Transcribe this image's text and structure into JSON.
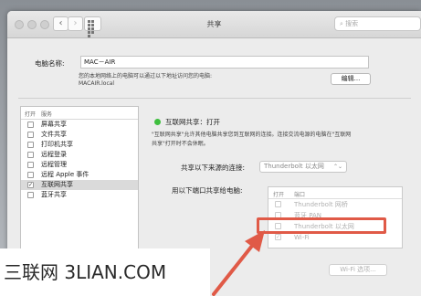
{
  "window": {
    "title": "共享",
    "search_placeholder": "搜索"
  },
  "computer_name": {
    "label": "电脑名称:",
    "value": "MAC－AIR",
    "hint_line1": "您的本地网络上的电脑可以通过以下地址访问您的电脑:",
    "hint_line2": "MACAIR.local",
    "edit_button": "编辑..."
  },
  "services": {
    "header_on": "打开",
    "header_service": "服务",
    "items": [
      {
        "label": "屏幕共享",
        "checked": false,
        "selected": false
      },
      {
        "label": "文件共享",
        "checked": false,
        "selected": false
      },
      {
        "label": "打印机共享",
        "checked": false,
        "selected": false
      },
      {
        "label": "远程登录",
        "checked": false,
        "selected": false
      },
      {
        "label": "远程管理",
        "checked": false,
        "selected": false
      },
      {
        "label": "远程 Apple 事件",
        "checked": false,
        "selected": false
      },
      {
        "label": "互联网共享",
        "checked": true,
        "selected": true
      },
      {
        "label": "蓝牙共享",
        "checked": false,
        "selected": false
      }
    ]
  },
  "detail": {
    "status": "互联网共享：打开",
    "status_color": "#3fbf3f",
    "description_line1": "\"互联网共享\"允许其他电脑共享您到互联网的连接。连接交流电源的电脑在\"互联网",
    "description_line2": "共享\"打开时不会休眠。",
    "share_from_label": "共享以下来源的连接:",
    "share_from_value": "Thunderbolt 以太网",
    "to_computers_label": "用以下端口共享给电脑:",
    "port_header_on": "打开",
    "port_header_port": "端口",
    "ports": [
      {
        "label": "Thunderbolt 网桥",
        "checked": false
      },
      {
        "label": "蓝牙 PAN",
        "checked": false
      },
      {
        "label": "Thunderbolt 以太网",
        "checked": false
      },
      {
        "label": "Wi-Fi",
        "checked": true
      }
    ],
    "wifi_options_button": "Wi-Fi 选项..."
  },
  "annotation": {
    "highlight_color": "#e05a47"
  },
  "watermark": {
    "text": "三联网 3LIAN.COM"
  }
}
